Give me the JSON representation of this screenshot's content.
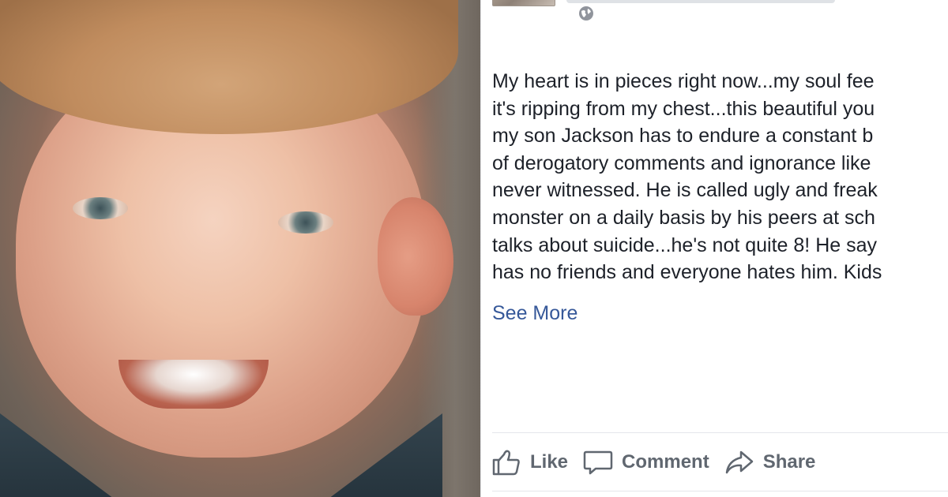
{
  "post": {
    "text_lines": [
      "My heart is in pieces right now...my soul fee",
      "it's ripping from my chest...this beautiful you",
      "my son Jackson has to endure a constant b",
      "of derogatory comments and ignorance like",
      "never witnessed. He is called ugly and freak",
      "monster on a daily basis by his peers at sch",
      "talks about suicide...he's not quite 8! He say",
      "has no friends and everyone hates him. Kids"
    ],
    "see_more": "See More",
    "privacy_icon": "globe-icon"
  },
  "actions": {
    "like": "Like",
    "comment": "Comment",
    "share": "Share"
  },
  "colors": {
    "text": "#1d2129",
    "link": "#365899",
    "action": "#606770"
  }
}
